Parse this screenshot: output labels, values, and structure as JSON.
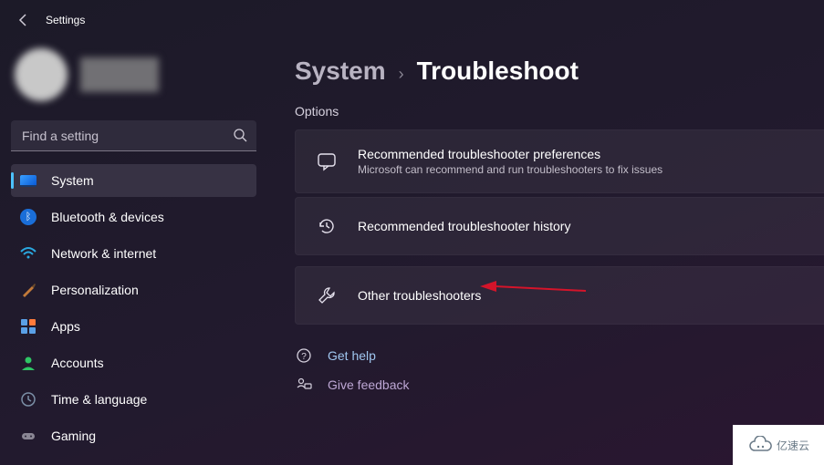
{
  "app": {
    "title": "Settings"
  },
  "search": {
    "placeholder": "Find a setting"
  },
  "sidebar": {
    "items": [
      {
        "label": "System"
      },
      {
        "label": "Bluetooth & devices"
      },
      {
        "label": "Network & internet"
      },
      {
        "label": "Personalization"
      },
      {
        "label": "Apps"
      },
      {
        "label": "Accounts"
      },
      {
        "label": "Time & language"
      },
      {
        "label": "Gaming"
      }
    ]
  },
  "breadcrumb": {
    "parent": "System",
    "sep": "›",
    "current": "Troubleshoot"
  },
  "section": {
    "label": "Options"
  },
  "cards": [
    {
      "title": "Recommended troubleshooter preferences",
      "sub": "Microsoft can recommend and run troubleshooters to fix issues"
    },
    {
      "title": "Recommended troubleshooter history"
    },
    {
      "title": "Other troubleshooters"
    }
  ],
  "links": {
    "help": "Get help",
    "feedback": "Give feedback"
  },
  "watermark": "亿速云"
}
